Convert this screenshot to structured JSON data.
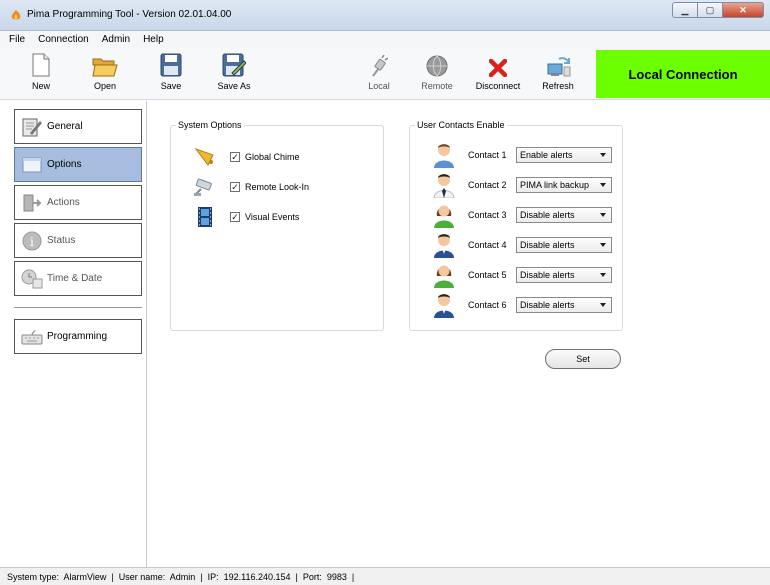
{
  "window": {
    "title": "Pima Programming Tool - Version 02.01.04.00"
  },
  "menu": [
    "File",
    "Connection",
    "Admin",
    "Help"
  ],
  "toolbar": {
    "new": "New",
    "open": "Open",
    "save": "Save",
    "save_as": "Save As",
    "local": "Local",
    "remote": "Remote",
    "disconnect": "Disconnect",
    "refresh": "Refresh"
  },
  "connection_status": "Local Connection",
  "sidebar": {
    "general": "General",
    "options": "Options",
    "actions": "Actions",
    "status": "Status",
    "time_date": "Time & Date",
    "programming": "Programming"
  },
  "system_options": {
    "title": "System Options",
    "items": [
      {
        "label": "Global Chime",
        "checked": true,
        "icon": "bell-icon"
      },
      {
        "label": "Remote Look-In",
        "checked": true,
        "icon": "camera-icon"
      },
      {
        "label": "Visual Events",
        "checked": true,
        "icon": "film-icon"
      }
    ]
  },
  "user_contacts": {
    "title": "User Contacts Enable",
    "contacts": [
      {
        "label": "Contact 1",
        "value": "Enable alerts"
      },
      {
        "label": "Contact 2",
        "value": "PIMA link backup"
      },
      {
        "label": "Contact 3",
        "value": "Disable alerts"
      },
      {
        "label": "Contact 4",
        "value": "Disable alerts"
      },
      {
        "label": "Contact 5",
        "value": "Disable alerts"
      },
      {
        "label": "Contact 6",
        "value": "Disable alerts"
      }
    ]
  },
  "set_button": "Set",
  "status_bar": "System type:  AlarmView  |  User name:  Admin  |  IP:  192.116.240.154  |  Port:  9983  |",
  "colors": {
    "connection_bg": "#6bff00",
    "active_nav": "#a6bde0"
  }
}
